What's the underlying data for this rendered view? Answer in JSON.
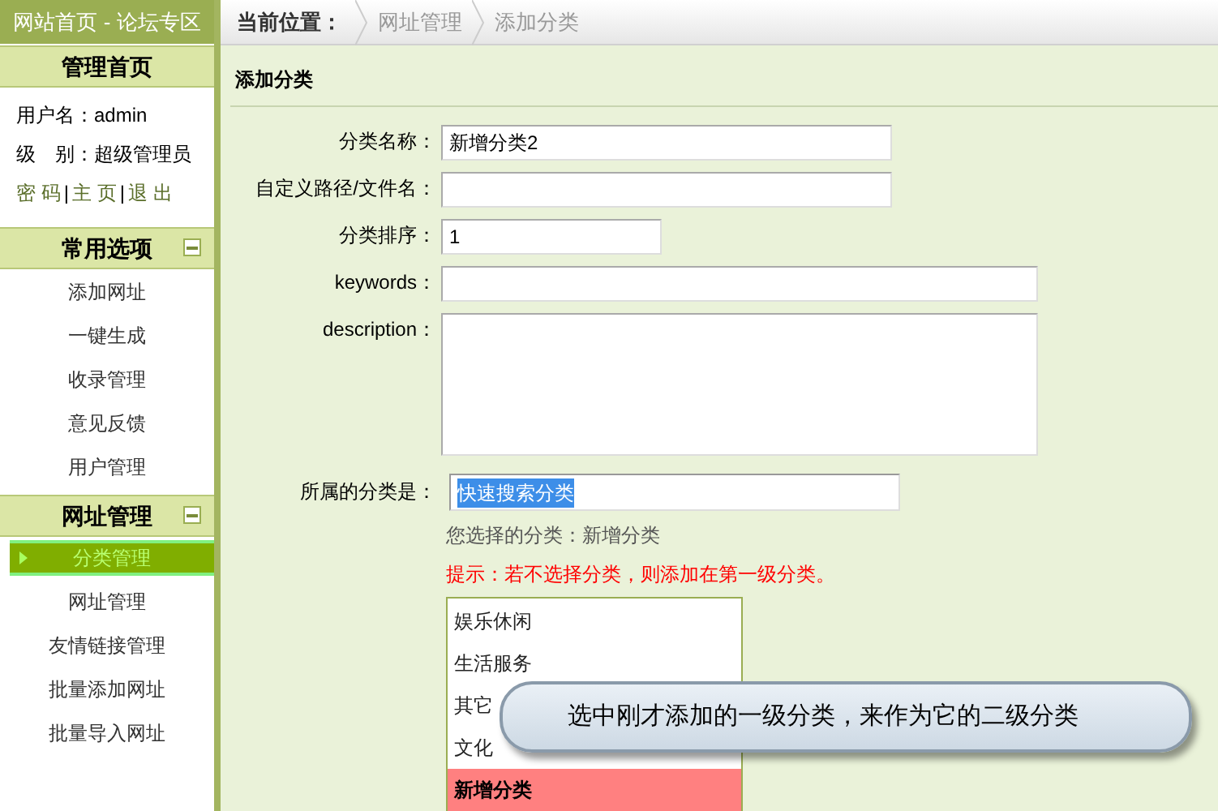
{
  "sidebar": {
    "site_title": "网站首页 - 论坛专区",
    "home_header": "管理首页",
    "user_info": [
      {
        "label": "用户名：",
        "value": "admin"
      },
      {
        "label": "级　别：",
        "value": "超级管理员"
      }
    ],
    "links": [
      "密 码",
      "主 页",
      "退 出"
    ],
    "link_separator": "|",
    "sections": [
      {
        "title": "常用选项",
        "expanded": true,
        "items": [
          {
            "label": "添加网址",
            "selected": false
          },
          {
            "label": "一键生成",
            "selected": false
          },
          {
            "label": "收录管理",
            "selected": false
          },
          {
            "label": "意见反馈",
            "selected": false
          },
          {
            "label": "用户管理",
            "selected": false
          }
        ]
      },
      {
        "title": "网址管理",
        "expanded": true,
        "items": [
          {
            "label": "分类管理",
            "selected": true
          },
          {
            "label": "网址管理",
            "selected": false
          },
          {
            "label": "友情链接管理",
            "selected": false
          },
          {
            "label": "批量添加网址",
            "selected": false
          },
          {
            "label": "批量导入网址",
            "selected": false
          }
        ]
      }
    ]
  },
  "breadcrumb": {
    "label": "当前位置：",
    "items": [
      "网址管理",
      "添加分类"
    ]
  },
  "panel_title": "添加分类",
  "form": [
    {
      "kind": "input",
      "label": "分类名称：",
      "value": "新增分类2"
    },
    {
      "kind": "input",
      "label": "自定义路径/文件名："
    },
    {
      "kind": "input",
      "label": "分类排序：",
      "value": "1"
    },
    {
      "kind": "input",
      "label": "keywords："
    },
    {
      "kind": "textarea",
      "label": "description："
    }
  ],
  "category": {
    "label": "所属的分类是：",
    "search_value": "快速搜索分类",
    "chosen_label": "您选择的分类：",
    "chosen_value": "新增分类",
    "hint": "提示：若不选择分类，则添加在第一级分类。",
    "options": [
      {
        "label": "娱乐休闲",
        "selected": false
      },
      {
        "label": "生活服务",
        "selected": false
      },
      {
        "label": "其它",
        "selected": false
      },
      {
        "label": "文化",
        "selected": false
      },
      {
        "label": "新增分类",
        "selected": true
      }
    ]
  },
  "callout": "选中刚才添加的一级分类，来作为它的二级分类"
}
